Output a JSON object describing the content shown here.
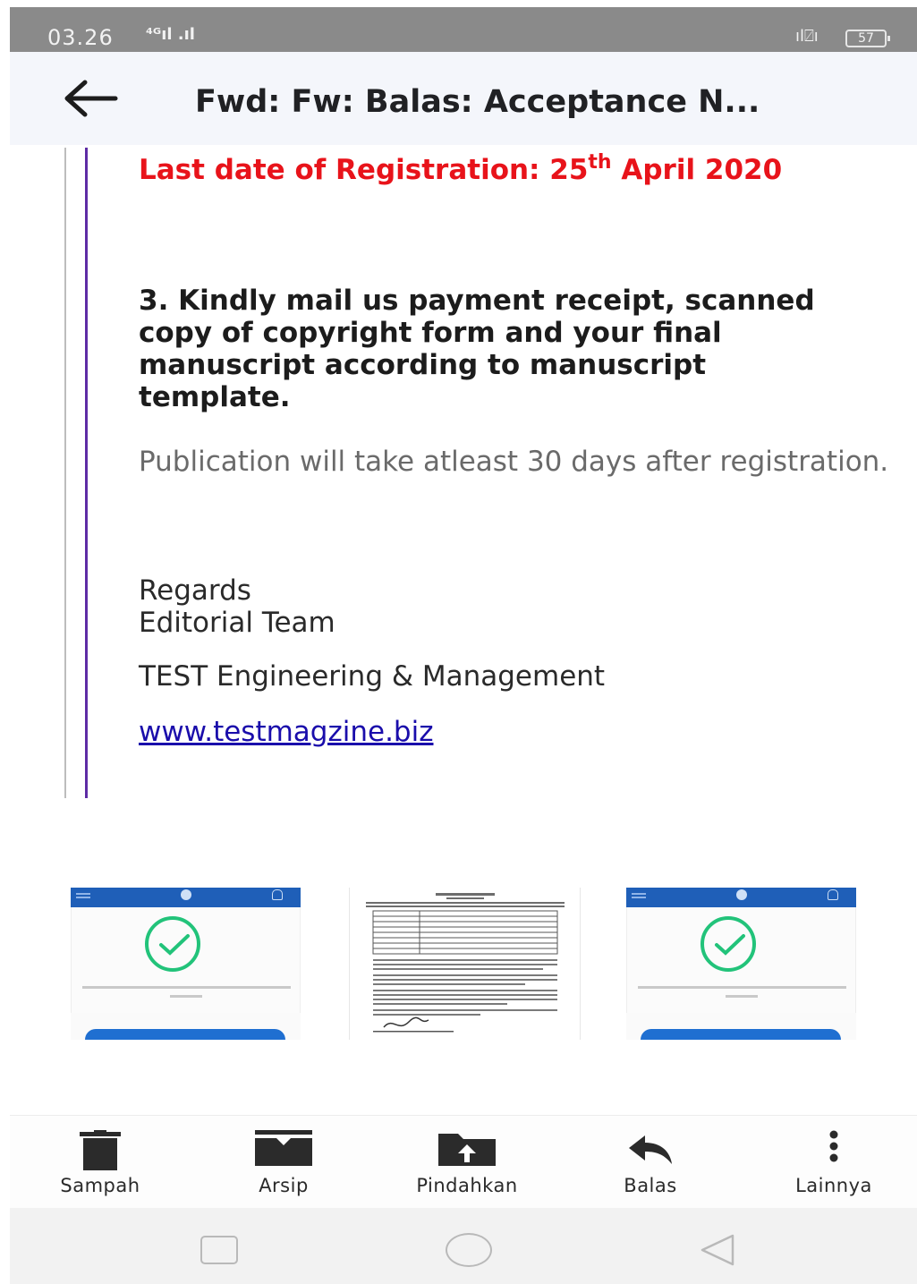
{
  "status": {
    "time": "03.26",
    "signal": "⁴ᴳıl .ıl",
    "battery": "57"
  },
  "header": {
    "title": "Fwd: Fw: Balas: Acceptance N..."
  },
  "email_body": {
    "registration_prefix": "Last date of Registration: 25",
    "registration_sup": "th",
    "registration_suffix": " April 2020",
    "instruction": "3. Kindly mail us payment receipt, scanned copy of copyright form and your final manuscript according to manuscript template.",
    "publication_note": "Publication will take atleast 30 days after registration.",
    "regards": "Regards",
    "team": "Editorial Team",
    "organization": "TEST Engineering & Management",
    "website": "www.testmagzine.biz"
  },
  "attachments": [
    {
      "icon": "payment-receipt-thumbnail"
    },
    {
      "icon": "copyright-form-thumbnail"
    },
    {
      "icon": "payment-receipt-thumbnail"
    }
  ],
  "actions": [
    {
      "label": "Sampah",
      "icon": "trash-icon"
    },
    {
      "label": "Arsip",
      "icon": "archive-icon"
    },
    {
      "label": "Pindahkan",
      "icon": "move-folder-icon"
    },
    {
      "label": "Balas",
      "icon": "reply-icon"
    },
    {
      "label": "Lainnya",
      "icon": "more-vertical-icon"
    }
  ],
  "colors": {
    "registration_red": "#e8131a",
    "link_blue": "#1a0dab",
    "quote_purple": "#5e2ca5",
    "check_green": "#22c37a"
  }
}
